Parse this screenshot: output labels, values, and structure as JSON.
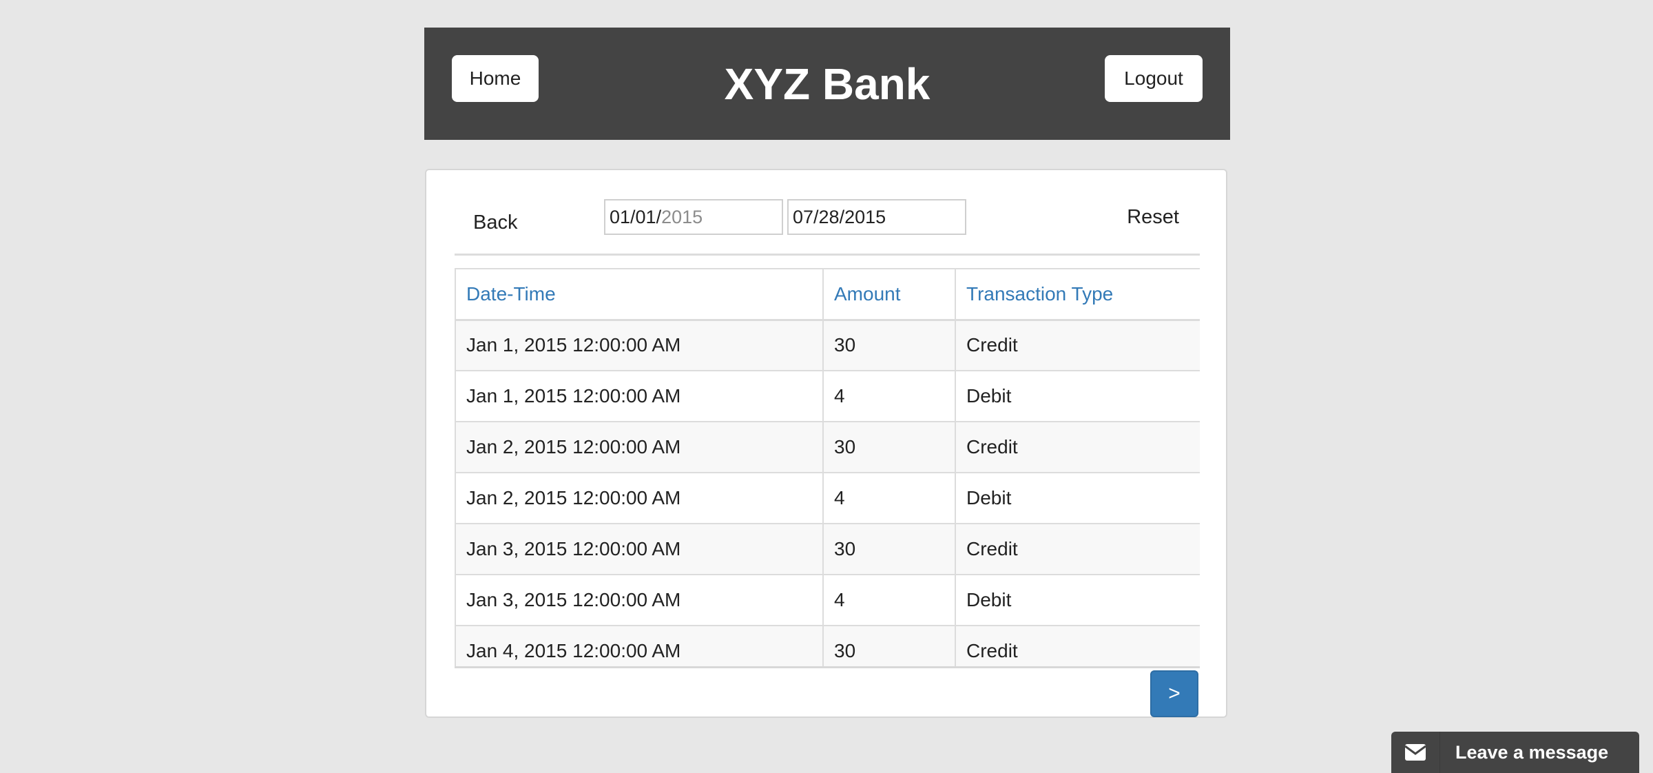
{
  "header": {
    "home_label": "Home",
    "brand_title": "XYZ Bank",
    "logout_label": "Logout"
  },
  "filters": {
    "back_label": "Back",
    "from_date_prefix": "01/01/",
    "from_date_year": "2015",
    "to_date": "07/28/2015",
    "reset_label": "Reset"
  },
  "table": {
    "columns": [
      "Date-Time",
      "Amount",
      "Transaction Type"
    ],
    "rows": [
      [
        "Jan 1, 2015 12:00:00 AM",
        "30",
        "Credit"
      ],
      [
        "Jan 1, 2015 12:00:00 AM",
        "4",
        "Debit"
      ],
      [
        "Jan 2, 2015 12:00:00 AM",
        "30",
        "Credit"
      ],
      [
        "Jan 2, 2015 12:00:00 AM",
        "4",
        "Debit"
      ],
      [
        "Jan 3, 2015 12:00:00 AM",
        "30",
        "Credit"
      ],
      [
        "Jan 3, 2015 12:00:00 AM",
        "4",
        "Debit"
      ],
      [
        "Jan 4, 2015 12:00:00 AM",
        "30",
        "Credit"
      ]
    ]
  },
  "pagination": {
    "next_label": ">"
  },
  "chat": {
    "label": "Leave a message",
    "icon": "envelope-icon"
  },
  "colors": {
    "header_bg": "#444444",
    "link_blue": "#337ab7",
    "page_bg": "#e7e7e7"
  }
}
